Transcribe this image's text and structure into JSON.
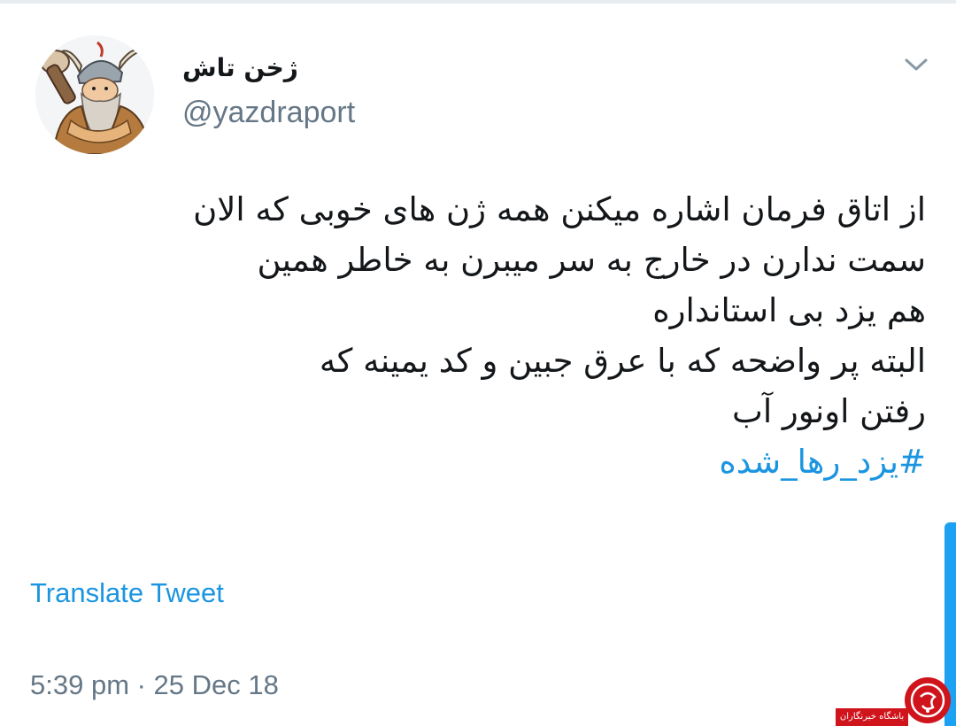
{
  "author": {
    "display_name": "ژخن تاش",
    "handle": "@yazdraport"
  },
  "tweet": {
    "lines": [
      "از اتاق فرمان اشاره میکنن همه ژن های خوبی که الان",
      "سمت ندارن در خارج به سر میبرن به خاطر همین",
      "هم یزد بی استانداره",
      "البته پر واضحه که با عرق جبین و کد یمینه که",
      "رفتن اونور آب"
    ],
    "hashtag": "#یزد_رها_شده"
  },
  "actions": {
    "translate_label": "Translate Tweet",
    "more_menu_icon": "chevron-down-icon"
  },
  "meta": {
    "timestamp": "5:39 pm · 25 Dec 18"
  },
  "watermark": {
    "text": "باشگاه خبرنگاران",
    "logo_letter": "ج"
  },
  "colors": {
    "link": "#1b95e0",
    "secondary_text": "#657786",
    "primary_text": "#14171a",
    "scrollbar": "#1da1f2",
    "watermark": "#d0141c"
  }
}
